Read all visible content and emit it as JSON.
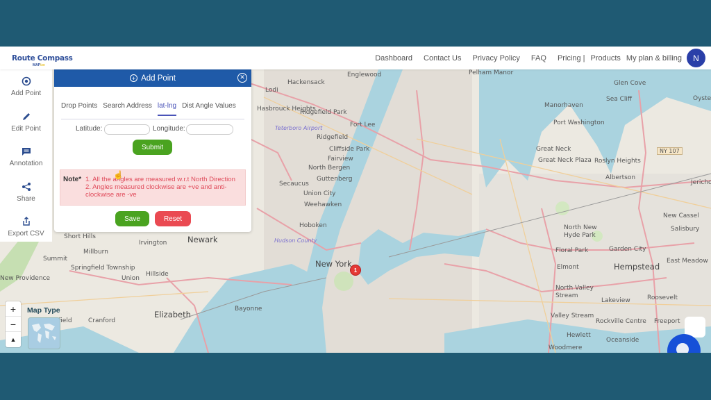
{
  "brand": {
    "name": "Route Compass",
    "sub_prefix": "MAP",
    "sub_suffix": "ize"
  },
  "nav": {
    "items": [
      "Dashboard",
      "Contact Us",
      "Privacy Policy",
      "FAQ",
      "Pricing |",
      "Products",
      "My plan & billing"
    ],
    "avatar_initial": "N"
  },
  "sidebar": {
    "items": [
      {
        "label": "Add Point",
        "icon": "add-circle-icon"
      },
      {
        "label": "Edit Point",
        "icon": "pencil-icon"
      },
      {
        "label": "Annotation",
        "icon": "comment-icon"
      },
      {
        "label": "Share",
        "icon": "share-icon"
      },
      {
        "label": "Export CSV",
        "icon": "export-icon"
      }
    ]
  },
  "panel": {
    "title": "Add Point",
    "tabs": [
      "Drop Points",
      "Search Address",
      "lat-lng",
      "Dist Angle Values"
    ],
    "active_tab": "lat-lng",
    "latitude_label": "Latitude:",
    "latitude_value": "",
    "longitude_label": "Longitude:",
    "longitude_value": "",
    "submit_label": "Submit",
    "note_label": "Note*",
    "note_lines": [
      "1. All the angles are measured w.r.t North Direction",
      "2. Angles measured clockwise are +ve and anti-clockwise are -ve"
    ],
    "save_label": "Save",
    "reset_label": "Reset"
  },
  "map": {
    "marker_count": "1",
    "map_type_label": "Map Type",
    "zoom_in": "+",
    "zoom_out": "−",
    "reset_north": "▲",
    "labels": [
      "Englewood",
      "Hackensack",
      "Lodi",
      "Hasbrouck Heights",
      "Ridgefield Park",
      "Fort Lee",
      "Teterboro Airport",
      "Ridgefield",
      "Cliffside Park",
      "Fairview",
      "North Bergen",
      "Secaucus",
      "Guttenberg",
      "Union City",
      "Weehawken",
      "Hoboken",
      "Hudson County",
      "New York",
      "Newark",
      "Short Hills",
      "Irvington",
      "Millburn",
      "Summit",
      "Springfield Township",
      "New Providence",
      "Union",
      "Hillside",
      "Elizabeth",
      "Cranford",
      "Westfield",
      "Bayonne",
      "Pelham Manor",
      "Manorhaven",
      "Port Washington",
      "Glen Cove",
      "Sea Cliff",
      "Great Neck",
      "Great Neck Plaza",
      "Roslyn Heights",
      "Albertson",
      "NY 107",
      "New Cassel",
      "Salisbury",
      "North New Hyde Park",
      "Floral Park",
      "Garden City",
      "East Meadow",
      "Elmont",
      "Hempstead",
      "North Valley Stream",
      "Lakeview",
      "Roosevelt",
      "Valley Stream",
      "Rockville Centre",
      "Freeport",
      "Hewlett",
      "Oceanside",
      "Woodmere",
      "Jericho",
      "Oyster Bay"
    ]
  }
}
